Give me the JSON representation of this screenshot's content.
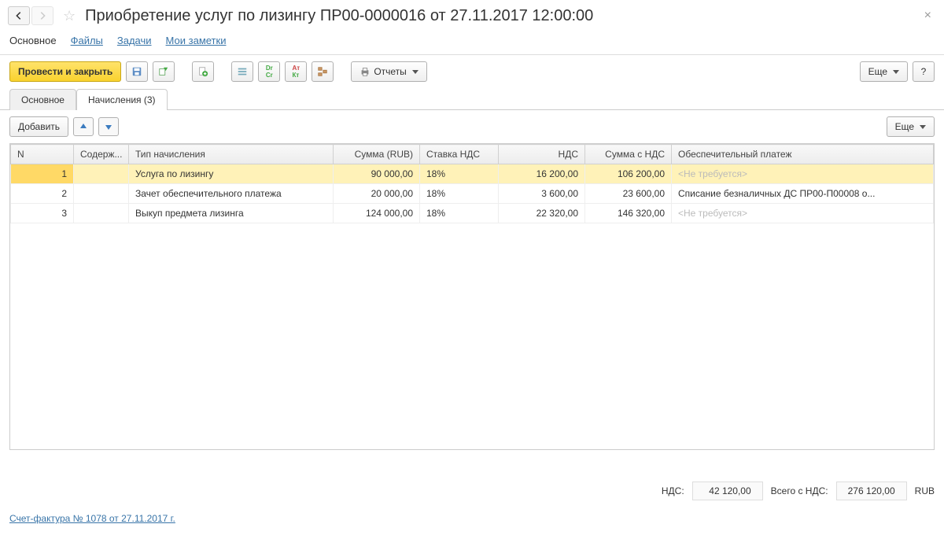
{
  "title": "Приобретение услуг по лизингу ПР00-0000016 от 27.11.2017 12:00:00",
  "nav": {
    "main": "Основное",
    "files": "Файлы",
    "tasks": "Задачи",
    "notes": "Мои заметки"
  },
  "toolbar": {
    "post_close": "Провести и закрыть",
    "reports": "Отчеты",
    "more": "Еще"
  },
  "subtabs": {
    "main": "Основное",
    "accruals": "Начисления (3)"
  },
  "tableTools": {
    "add": "Добавить",
    "more": "Еще"
  },
  "columns": {
    "n": "N",
    "content": "Содерж...",
    "type": "Тип начисления",
    "amount": "Сумма (RUB)",
    "vat_rate": "Ставка НДС",
    "vat": "НДС",
    "total": "Сумма с НДС",
    "deposit": "Обеспечительный платеж"
  },
  "rows": [
    {
      "n": "1",
      "content": "",
      "type": "Услуга по лизингу",
      "amount": "90 000,00",
      "vat_rate": "18%",
      "vat": "16 200,00",
      "total": "106 200,00",
      "deposit": "<Не требуется>",
      "placeholder": true,
      "selected": true
    },
    {
      "n": "2",
      "content": "",
      "type": "Зачет обеспечительного платежа",
      "amount": "20 000,00",
      "vat_rate": "18%",
      "vat": "3 600,00",
      "total": "23 600,00",
      "deposit": "Списание безналичных ДС ПР00-П00008 о...",
      "placeholder": false,
      "selected": false
    },
    {
      "n": "3",
      "content": "",
      "type": "Выкуп предмета лизинга",
      "amount": "124 000,00",
      "vat_rate": "18%",
      "vat": "22 320,00",
      "total": "146 320,00",
      "deposit": "<Не требуется>",
      "placeholder": true,
      "selected": false
    }
  ],
  "totals": {
    "vat_label": "НДС:",
    "vat": "42 120,00",
    "total_label": "Всего с НДС:",
    "total": "276 120,00",
    "currency": "RUB"
  },
  "invoice_link": "Счет-фактура № 1078 от 27.11.2017 г.",
  "help": "?"
}
